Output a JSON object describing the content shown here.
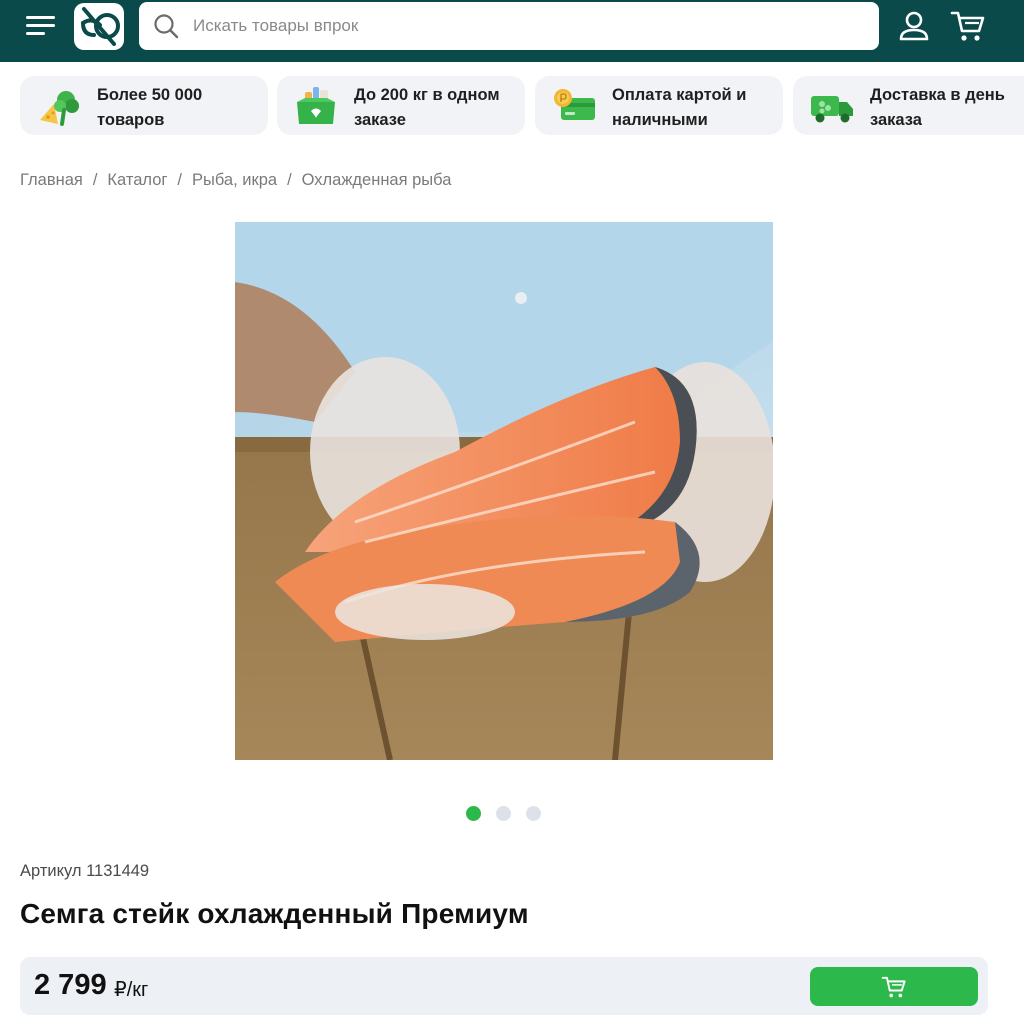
{
  "header": {
    "search_placeholder": "Искать товары впрок",
    "icons": {
      "menu": "menu-icon",
      "logo": "logo-icon",
      "search": "search-icon",
      "user": "user-icon",
      "cart": "cart-icon"
    },
    "colors": {
      "background": "#0b4a4a",
      "accent": "#2cb84a"
    }
  },
  "features": [
    {
      "line1": "Более 50 000",
      "line2": "товаров",
      "icon": "groceries-icon"
    },
    {
      "line1": "До 200 кг в одном",
      "line2": "заказе",
      "icon": "box-icon"
    },
    {
      "line1": "Оплата картой и",
      "line2": "наличными",
      "icon": "payment-card-icon"
    },
    {
      "line1": "Доставка в день",
      "line2": "заказа",
      "icon": "delivery-truck-icon"
    }
  ],
  "breadcrumb": [
    "Главная",
    "Каталог",
    "Рыба, икра",
    "Охлажденная рыба"
  ],
  "breadcrumb_separator": "/",
  "gallery": {
    "count": 3,
    "active_index": 0
  },
  "product": {
    "article": "Артикул 1131449",
    "title": "Семга стейк охлажденный Премиум",
    "price": "2 799",
    "price_unit": "₽/кг"
  }
}
